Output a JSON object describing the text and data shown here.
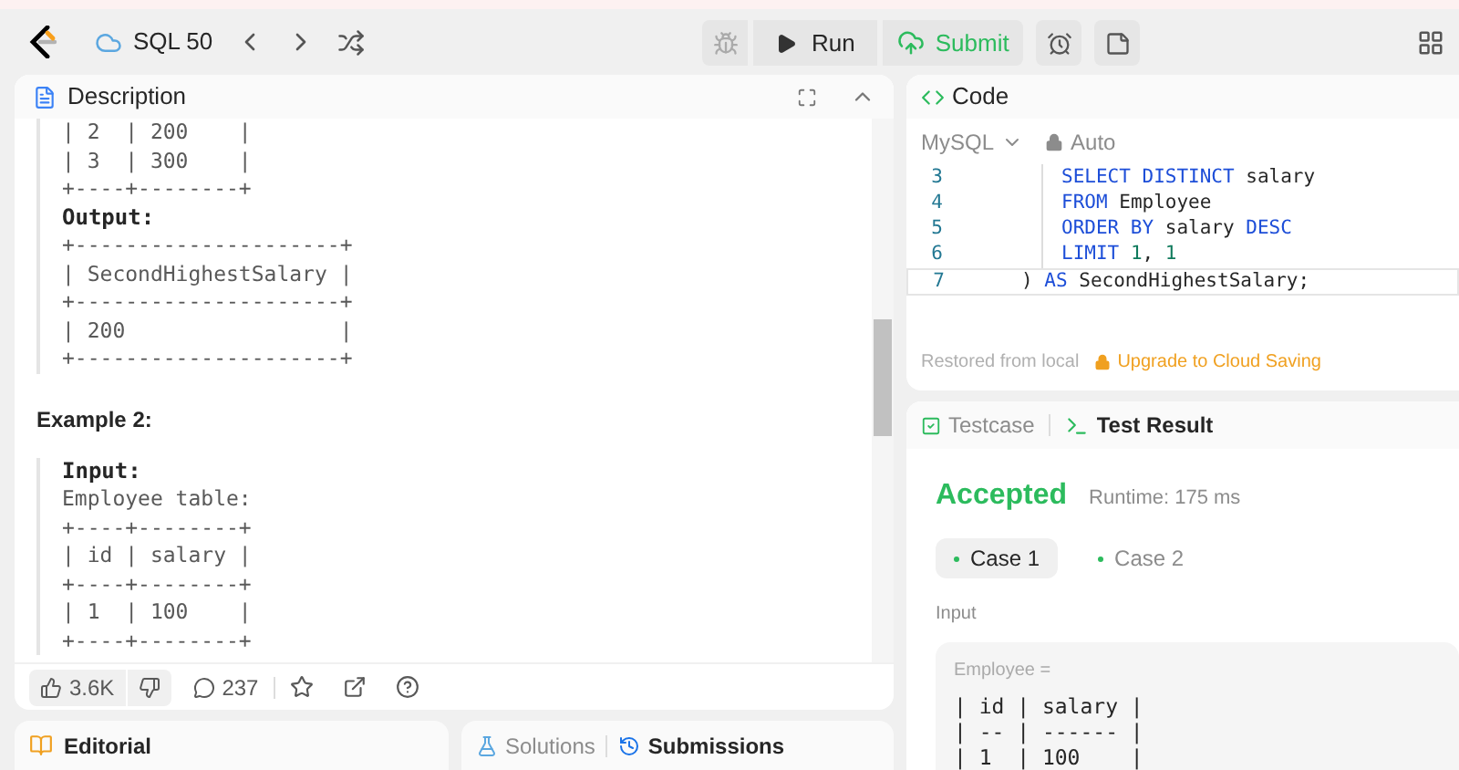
{
  "topbar": {
    "problem_list": "SQL 50",
    "run": "Run",
    "submit": "Submit"
  },
  "description": {
    "title": "Description",
    "block_1": [
      {
        "kind": "plain",
        "text": "| 2  | 200    |"
      },
      {
        "kind": "plain",
        "text": "| 3  | 300    |"
      },
      {
        "kind": "plain",
        "text": "+----+--------+"
      },
      {
        "kind": "label",
        "text": "Output:"
      },
      {
        "kind": "plain",
        "text": "+---------------------+"
      },
      {
        "kind": "plain",
        "text": "| SecondHighestSalary |"
      },
      {
        "kind": "plain",
        "text": "+---------------------+"
      },
      {
        "kind": "plain",
        "text": "| 200                 |"
      },
      {
        "kind": "plain",
        "text": "+---------------------+"
      }
    ],
    "example_heading": "Example 2:",
    "block_2": [
      {
        "kind": "label",
        "text": "Input:"
      },
      {
        "kind": "plain",
        "text": "Employee table:"
      },
      {
        "kind": "plain",
        "text": "+----+--------+"
      },
      {
        "kind": "plain",
        "text": "| id | salary |"
      },
      {
        "kind": "plain",
        "text": "+----+--------+"
      },
      {
        "kind": "plain",
        "text": "| 1  | 100    |"
      },
      {
        "kind": "plain",
        "text": "+----+--------+"
      }
    ],
    "likes": "3.6K",
    "comments": "237"
  },
  "code": {
    "title": "Code",
    "language": "MySQL",
    "auto": "Auto",
    "lines": [
      {
        "number": "3",
        "kind": "body",
        "tokens": [
          {
            "kind": "keyword",
            "text": "SELECT DISTINCT"
          },
          {
            "kind": "plain",
            "text": " salary"
          }
        ]
      },
      {
        "number": "4",
        "kind": "body",
        "tokens": [
          {
            "kind": "keyword",
            "text": "FROM"
          },
          {
            "kind": "plain",
            "text": " Employee"
          }
        ]
      },
      {
        "number": "5",
        "kind": "body",
        "tokens": [
          {
            "kind": "keyword",
            "text": "ORDER BY"
          },
          {
            "kind": "plain",
            "text": " salary "
          },
          {
            "kind": "keyword",
            "text": "DESC"
          }
        ]
      },
      {
        "number": "6",
        "kind": "body",
        "tokens": [
          {
            "kind": "keyword",
            "text": "LIMIT "
          },
          {
            "kind": "number",
            "text": "1"
          },
          {
            "kind": "plain",
            "text": ", "
          },
          {
            "kind": "number",
            "text": "1"
          }
        ]
      },
      {
        "number": "7",
        "kind": "closing",
        "tokens": [
          {
            "kind": "plain",
            "text": ") "
          },
          {
            "kind": "keyword",
            "text": "AS"
          },
          {
            "kind": "plain",
            "text": " SecondHighestSalary;"
          }
        ]
      }
    ],
    "restored": "Restored from local",
    "upgrade": "Upgrade to Cloud Saving"
  },
  "result": {
    "tabs": [
      {
        "label": "Testcase",
        "selected": false
      },
      {
        "label": "Test Result",
        "selected": true
      }
    ],
    "status": "Accepted",
    "runtime": "Runtime: 175 ms",
    "cases": [
      {
        "label": "Case 1",
        "selected": true
      },
      {
        "label": "Case 2",
        "selected": false
      }
    ],
    "input_label": "Input",
    "variable": "Employee =",
    "table_lines": [
      "| id | salary |",
      "| -- | ------ |",
      "| 1  | 100    |"
    ]
  },
  "bottom_tabs": {
    "editorial": "Editorial",
    "tabs": [
      {
        "label": "Solutions",
        "selected": false
      },
      {
        "label": "Submissions",
        "selected": true
      }
    ]
  }
}
